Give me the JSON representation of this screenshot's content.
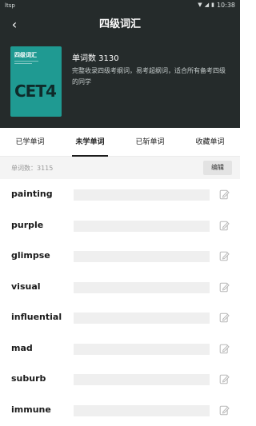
{
  "status_bar": {
    "carrier": "ltsp",
    "time": "10:38",
    "icons": [
      "signal-icon",
      "wifi-icon",
      "battery-icon"
    ]
  },
  "header": {
    "back_icon": "chevron-left-icon",
    "title": "四级词汇",
    "book_cover": {
      "title": "四级词汇",
      "logo": "CET4",
      "color": "#1f9a92"
    },
    "word_count": "单词数 3130",
    "description": "完整收录四级考纲词，易考超纲词，适合所有备考四级的同学"
  },
  "tabs": [
    {
      "label": "已学单词",
      "active": false
    },
    {
      "label": "未学单词",
      "active": true
    },
    {
      "label": "已斩单词",
      "active": false
    },
    {
      "label": "收藏单词",
      "active": false
    }
  ],
  "list_header": {
    "count_label": "单词数：3115",
    "edit_label": "编辑"
  },
  "words": [
    {
      "word": "painting"
    },
    {
      "word": "purple"
    },
    {
      "word": "glimpse"
    },
    {
      "word": "visual"
    },
    {
      "word": "influential"
    },
    {
      "word": "mad"
    },
    {
      "word": "suburb"
    },
    {
      "word": "immune"
    }
  ],
  "colors": {
    "header_bg": "#252b2b",
    "accent": "#1f9a92"
  }
}
